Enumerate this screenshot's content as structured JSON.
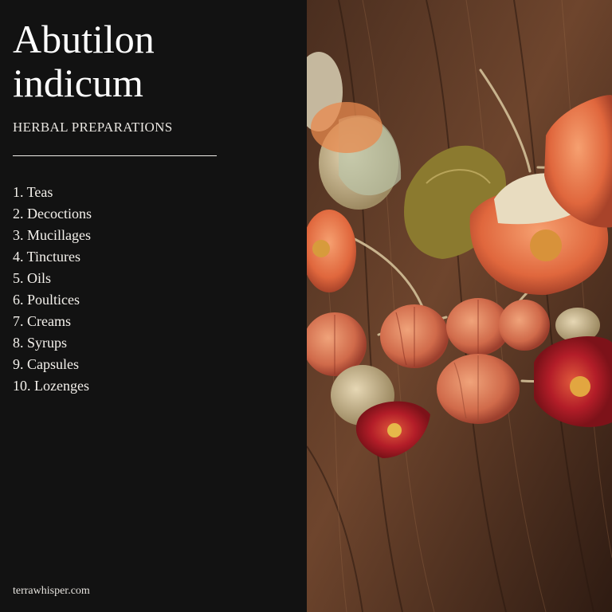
{
  "header": {
    "title_line1": "Abutilon",
    "title_line2": "indicum",
    "subtitle": "HERBAL PREPARATIONS"
  },
  "list": {
    "items": [
      "1. Teas",
      "2. Decoctions",
      "3. Mucillages",
      "4. Tinctures",
      "5. Oils",
      "6. Poultices",
      "7. Creams",
      "8. Syrups",
      "9. Capsules",
      "10. Lozenges"
    ]
  },
  "footer": {
    "site": "terrawhisper.com"
  },
  "colors": {
    "panel_bg": "#121212",
    "text": "#f4f1ec",
    "wood_dark": "#3b2418",
    "wood_light": "#8a5a3c",
    "flower_red": "#b8202a",
    "husk_orange": "#d9774f",
    "husk_tan": "#c9b48d"
  },
  "photo": {
    "icon": "dried-abutilon-flowers-photo"
  }
}
